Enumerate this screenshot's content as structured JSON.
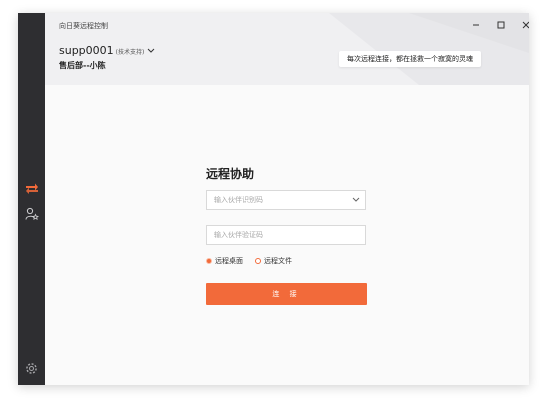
{
  "app": {
    "title": "向日葵远程控制"
  },
  "window_controls": {
    "minimize_icon": "minimize-icon",
    "maximize_icon": "maximize-icon",
    "close_icon": "close-icon"
  },
  "user": {
    "name": "supp0001",
    "role": "(技术支持)",
    "department": "售后部--小陈"
  },
  "slogan": "每次远程连接，都在拯救一个寂寞的灵魂",
  "sidebar": {
    "items": [
      {
        "icon": "remote-transfer-icon",
        "active": true
      },
      {
        "icon": "contacts-star-icon",
        "active": false
      }
    ],
    "settings_icon": "gear-icon"
  },
  "form": {
    "title": "远程协助",
    "partner_id_placeholder": "输入伙伴识别码",
    "verify_code_placeholder": "输入伙伴验证码",
    "options": [
      {
        "label": "远程桌面",
        "selected": true
      },
      {
        "label": "远程文件",
        "selected": false
      }
    ],
    "connect_label": "连 接"
  },
  "colors": {
    "accent": "#f26a3a",
    "sidebar": "#2e2e31",
    "header": "#f0f0f2"
  }
}
